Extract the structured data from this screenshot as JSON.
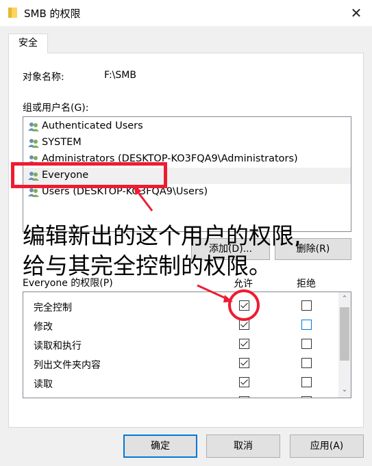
{
  "window": {
    "title": "SMB 的权限",
    "close_glyph": "✕"
  },
  "tabs": [
    {
      "label": "安全"
    }
  ],
  "object_name": {
    "label": "对象名称:",
    "value": "F:\\SMB"
  },
  "group_list": {
    "label": "组或用户名(G):",
    "items": [
      {
        "name": "Authenticated Users",
        "icon": "users-icon"
      },
      {
        "name": "SYSTEM",
        "icon": "users-icon"
      },
      {
        "name": "Administrators (DESKTOP-KO3FQA9\\Administrators)",
        "icon": "users-icon"
      },
      {
        "name": "Everyone",
        "icon": "users-icon",
        "selected": true
      },
      {
        "name": "Users (DESKTOP-KO3FQA9\\Users)",
        "icon": "users-icon"
      }
    ]
  },
  "buttons": {
    "add": "添加(D)...",
    "remove": "删除(R)"
  },
  "permissions": {
    "label": "Everyone 的权限(P)",
    "allow_header": "允许",
    "deny_header": "拒绝",
    "rows": [
      {
        "name": "完全控制",
        "allow": true,
        "deny": false
      },
      {
        "name": "修改",
        "allow": true,
        "deny": false
      },
      {
        "name": "读取和执行",
        "allow": true,
        "deny": false
      },
      {
        "name": "列出文件夹内容",
        "allow": true,
        "deny": false
      },
      {
        "name": "读取",
        "allow": true,
        "deny": false
      }
    ]
  },
  "footer": {
    "ok": "确定",
    "cancel": "取消",
    "apply": "应用(A)"
  },
  "annotation": {
    "line1": "编辑新出的这个用户的权限,",
    "line2": "给与其完全控制的权限。",
    "color": "#ee1c32"
  },
  "colors": {
    "accent": "#0078d7",
    "dialog_bg": "#f0f0f0",
    "annotation_red": "#ee1c32"
  }
}
